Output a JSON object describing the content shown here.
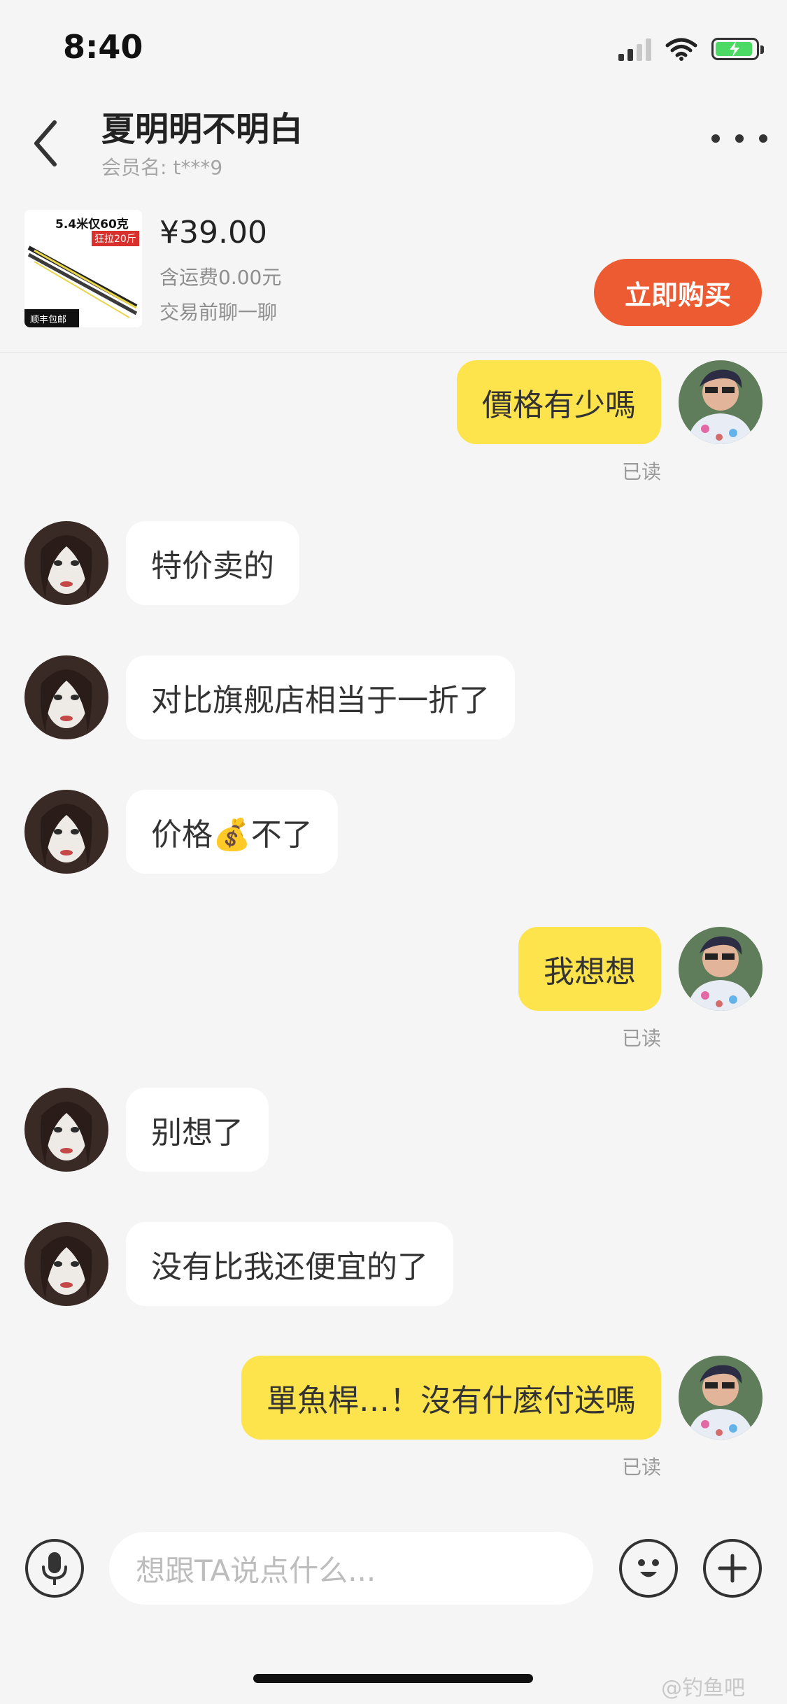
{
  "status_bar": {
    "time": "8:40"
  },
  "header": {
    "title": "夏明明不明白",
    "member_label": "会员名: t***9"
  },
  "product": {
    "thumb_badge": "5.4米仅60克",
    "thumb_tag": "狂拉20斤",
    "thumb_ship": "顺丰包邮",
    "price": "¥39.00",
    "shipping": "含运费0.00元",
    "hint": "交易前聊一聊",
    "buy_label": "立即购买"
  },
  "messages": [
    {
      "dir": "out",
      "text": "價格有少嗎",
      "status": "已读"
    },
    {
      "dir": "in",
      "text": "特价卖的"
    },
    {
      "dir": "in",
      "text": "对比旗舰店相当于一折了"
    },
    {
      "dir": "in",
      "text": "价格💰不了"
    },
    {
      "dir": "out",
      "text": "我想想",
      "status": "已读"
    },
    {
      "dir": "in",
      "text": "别想了"
    },
    {
      "dir": "in",
      "text": "没有比我还便宜的了"
    },
    {
      "dir": "out",
      "text": "單魚桿…！沒有什麼付送嗎",
      "status": "已读"
    }
  ],
  "input": {
    "placeholder": "想跟TA说点什么..."
  },
  "watermark": "@钓鱼吧",
  "colors": {
    "accent_buy": "#ec5b31",
    "bubble_out": "#fde34c",
    "bubble_in": "#ffffff",
    "battery": "#4cd964"
  }
}
